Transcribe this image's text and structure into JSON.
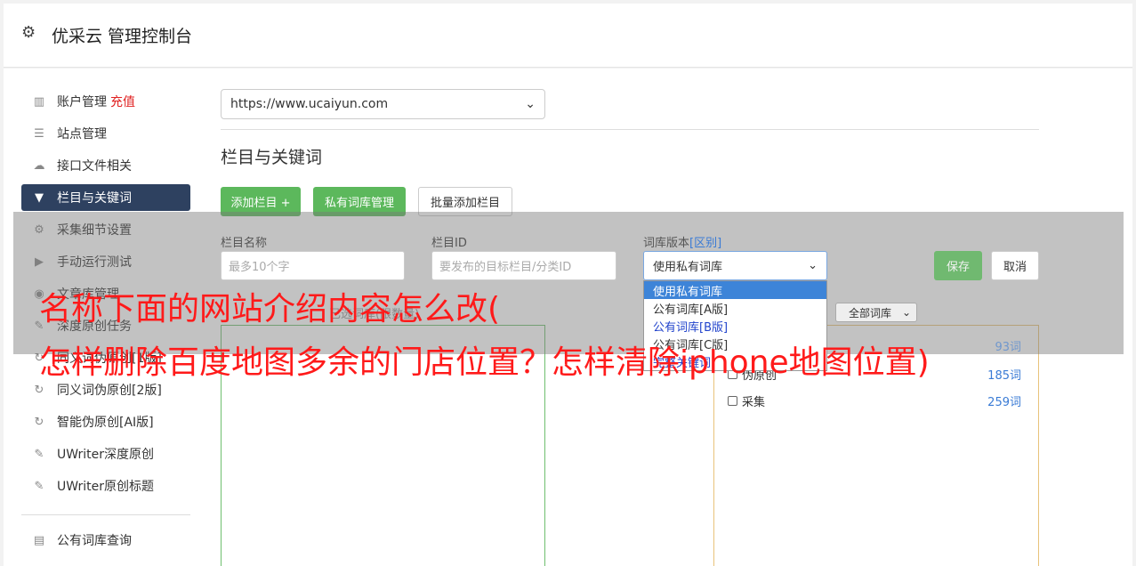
{
  "header": {
    "title": "优采云 管理控制台",
    "icon": "gear-icon"
  },
  "sidebar": {
    "items": [
      {
        "label": "账户管理",
        "badge": "充值",
        "icon": "bar-chart-icon"
      },
      {
        "label": "站点管理",
        "icon": "server-icon"
      },
      {
        "label": "接口文件相关",
        "icon": "cloud-upload-icon"
      },
      {
        "label": "栏目与关键词",
        "icon": "filter-icon",
        "active": true
      },
      {
        "label": "采集细节设置",
        "icon": "cogs-icon"
      },
      {
        "label": "手动运行测试",
        "icon": "play-circle-icon"
      },
      {
        "label": "文章库管理",
        "icon": "database-icon"
      },
      {
        "label": "深度原创任务",
        "icon": "edit-icon"
      },
      {
        "label": "同义词伪原创[1版]",
        "icon": "refresh-icon"
      },
      {
        "label": "同义词伪原创[2版]",
        "icon": "refresh-icon"
      },
      {
        "label": "智能伪原创[AI版]",
        "icon": "refresh-icon"
      },
      {
        "label": "UWriter深度原创",
        "icon": "edit-icon"
      },
      {
        "label": "UWriter原创标题",
        "icon": "edit-icon"
      }
    ],
    "bottom_items": [
      {
        "label": "公有词库查询",
        "icon": "book-icon"
      }
    ]
  },
  "main": {
    "site_select": "https://www.ucaiyun.com",
    "section_title": "栏目与关键词",
    "buttons": {
      "add_column": "添加栏目 +",
      "private_lib": "私有词库管理",
      "batch_add": "批量添加栏目"
    },
    "form": {
      "name_label": "栏目名称",
      "name_placeholder": "最多10个字",
      "id_label": "栏目ID",
      "id_placeholder": "要发布的目标栏目/分类ID",
      "version_label": "词库版本",
      "version_diff": "[区别]",
      "version_value": "使用私有词库",
      "save": "保存",
      "cancel": "取消"
    },
    "dropdown_options": [
      "使用私有词库",
      "公有词库[A版]",
      "公有词库[B版]",
      "公有词库[C版]",
      "完整关键词"
    ],
    "keyword_heading": "已选词库(限数量)",
    "lib_filter": "全部词库",
    "lib_rows": [
      {
        "label": "…",
        "count": "93词"
      },
      {
        "label": "伪原创",
        "count": "185词"
      },
      {
        "label": "采集",
        "count": "259词"
      }
    ]
  },
  "overlay": {
    "line1": "名称下面的网站介绍内容怎么改(",
    "line2": "怎样删除百度地图多余的门店位置？怎样清除iphone地图位置)"
  },
  "colors": {
    "green": "#5cb85c",
    "navy": "#2e4160",
    "red_text": "#ff1a1a"
  }
}
